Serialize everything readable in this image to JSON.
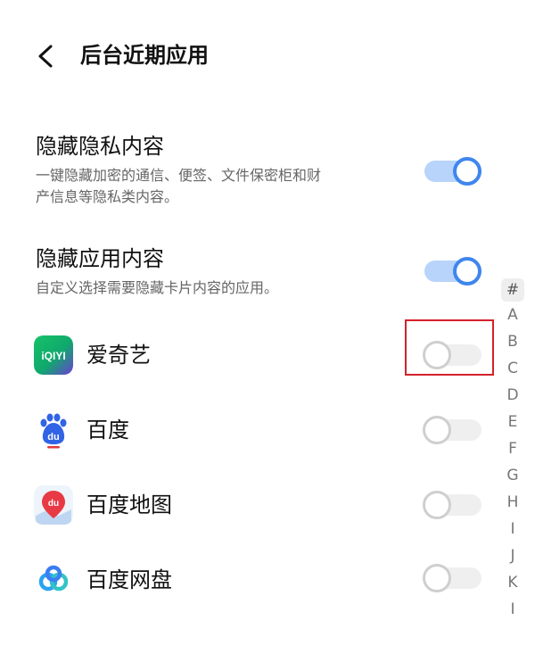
{
  "header": {
    "title": "后台近期应用"
  },
  "settings": [
    {
      "title": "隐藏隐私内容",
      "desc_line1": "一键隐藏加密的通信、便签、文件保密柜和财",
      "desc_line2": "产信息等隐私类内容。",
      "enabled": true
    },
    {
      "title": "隐藏应用内容",
      "desc_line1": "自定义选择需要隐藏卡片内容的应用。",
      "enabled": true
    }
  ],
  "apps": [
    {
      "name": "爱奇艺",
      "icon": "iqiyi-icon",
      "icon_text": "iQIYI",
      "enabled": false
    },
    {
      "name": "百度",
      "icon": "baidu-icon",
      "icon_text": "du",
      "enabled": false
    },
    {
      "name": "百度地图",
      "icon": "baidu-map-icon",
      "icon_text": "du",
      "enabled": false
    },
    {
      "name": "百度网盘",
      "icon": "baidu-netdisk-icon",
      "enabled": false
    }
  ],
  "index_bar": [
    "#",
    "A",
    "B",
    "C",
    "D",
    "E",
    "F",
    "G",
    "H",
    "I",
    "J",
    "K",
    "I"
  ],
  "colors": {
    "accent": "#3f86ee",
    "accent_track": "#b9d4fb",
    "highlight": "#d4222a"
  }
}
